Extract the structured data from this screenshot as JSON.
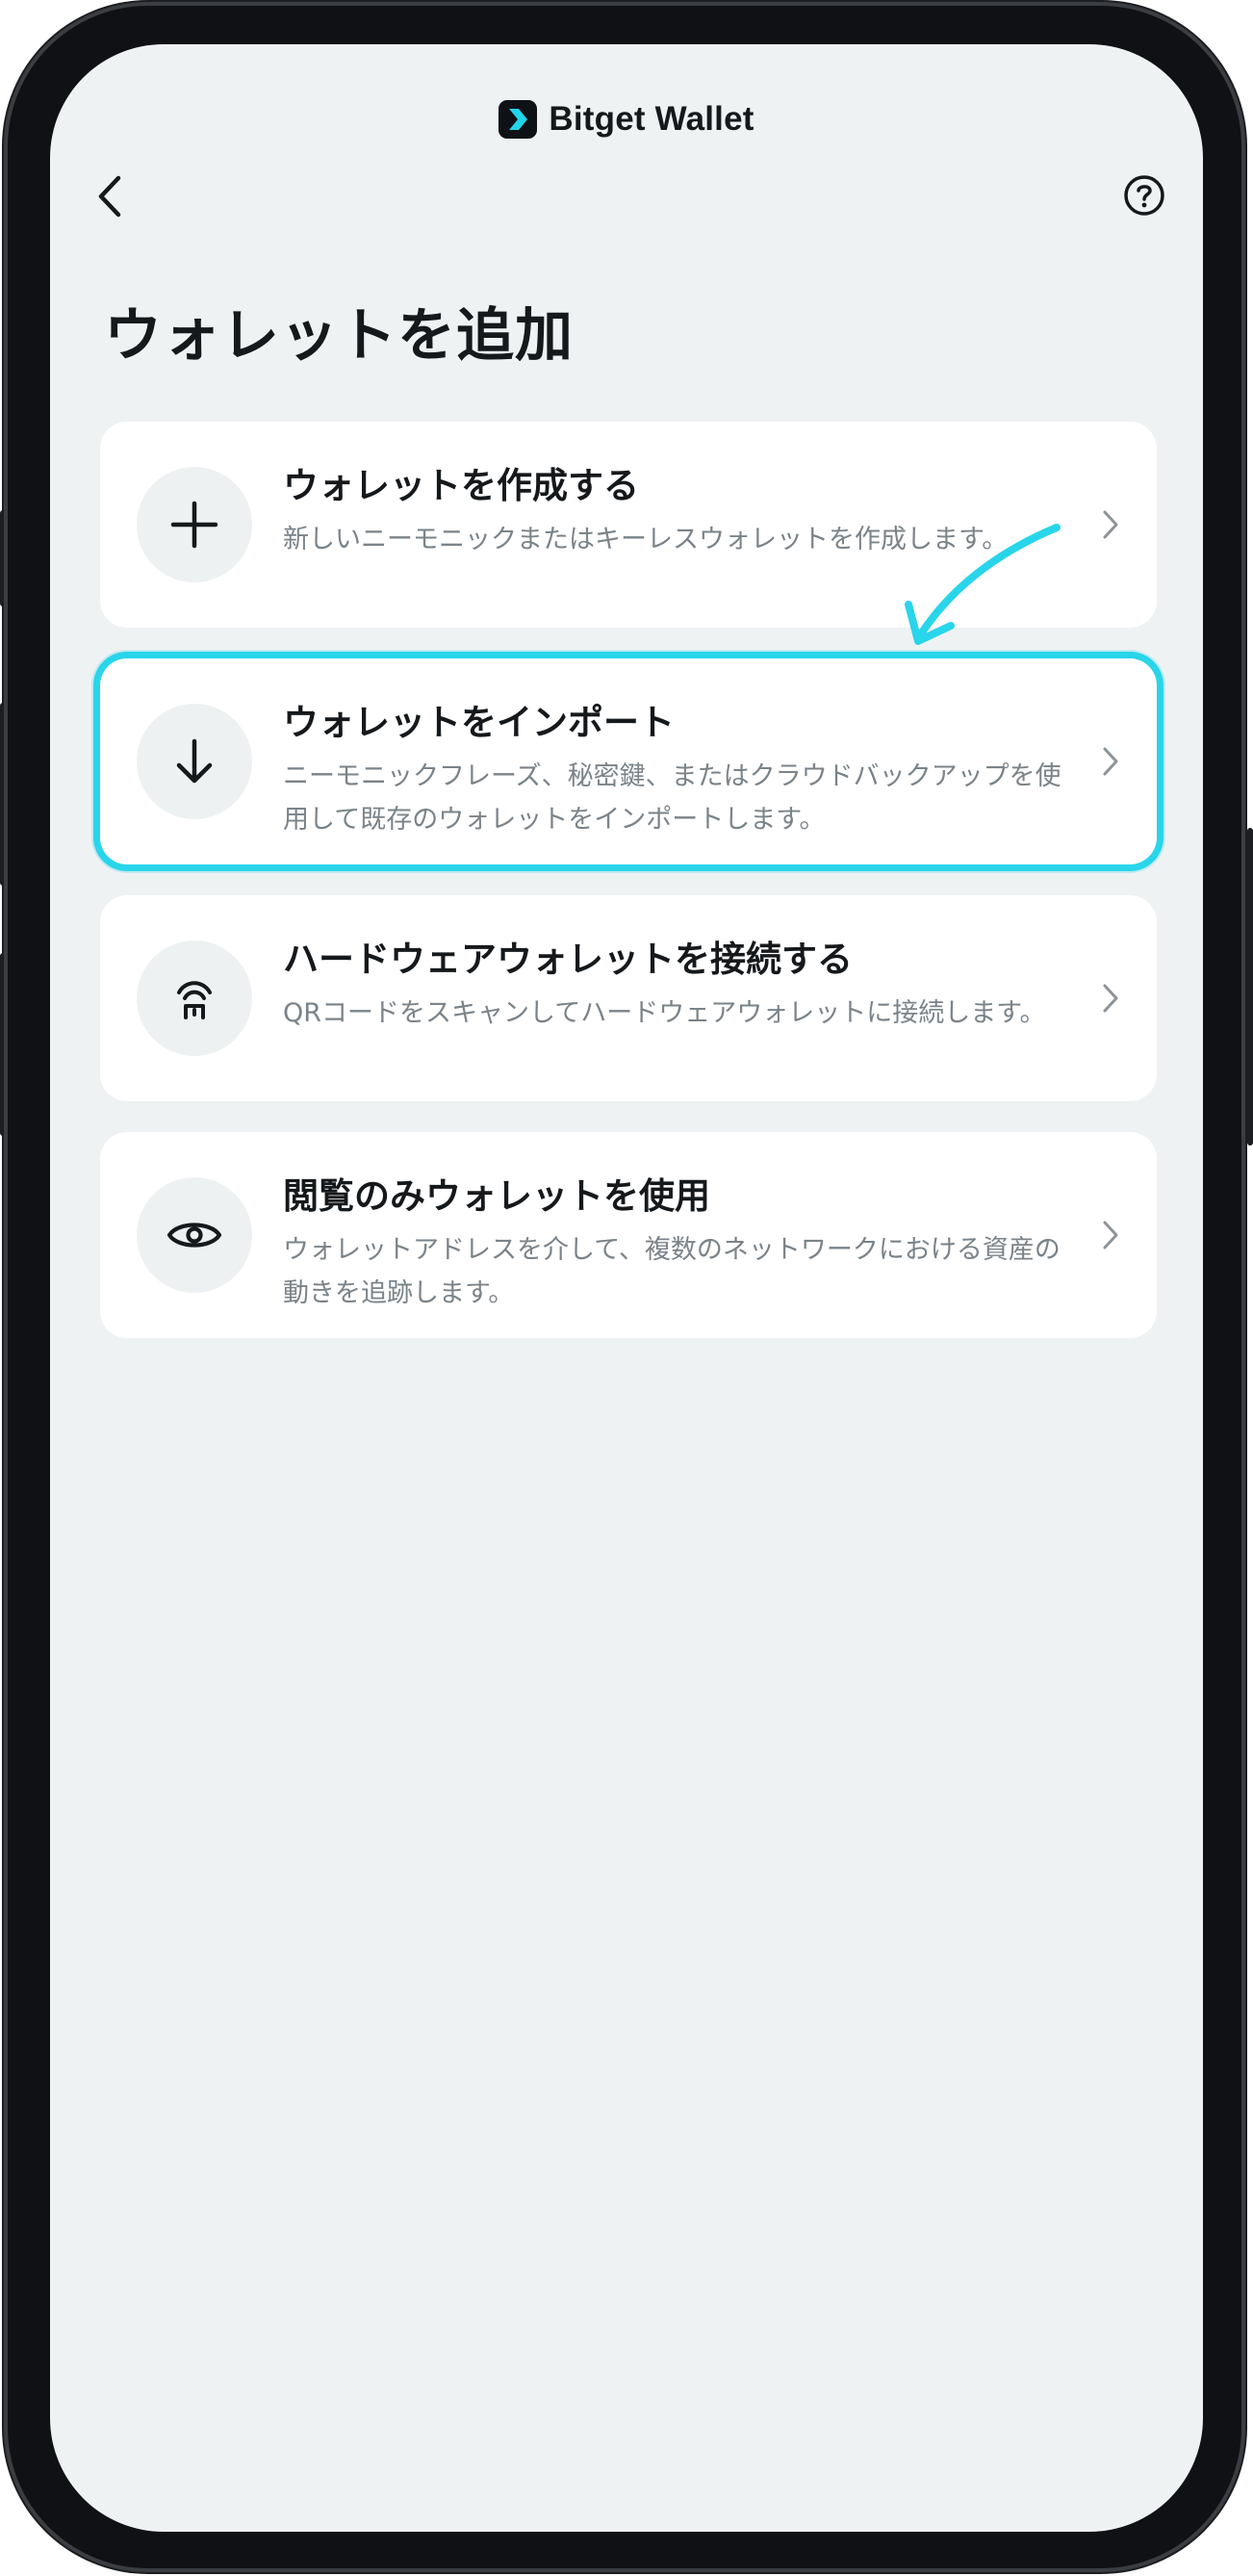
{
  "header": {
    "brand_name": "Bitget Wallet",
    "back_icon": "chevron-left-icon",
    "help_icon": "question-circle-icon"
  },
  "page": {
    "title": "ウォレットを追加"
  },
  "options": [
    {
      "icon": "plus-icon",
      "title": "ウォレットを作成する",
      "description": "新しいニーモニックまたはキーレスウォレットを作成します。"
    },
    {
      "icon": "arrow-down-icon",
      "title": "ウォレットをインポート",
      "description": "ニーモニックフレーズ、秘密鍵、またはクラウドバックアップを使用して既存のウォレットをインポートします。",
      "highlighted": true
    },
    {
      "icon": "hardware-wallet-icon",
      "title": "ハードウェアウォレットを接続する",
      "description": "QRコードをスキャンしてハードウェアウォレットに接続します。"
    },
    {
      "icon": "eye-icon",
      "title": "閲覧のみウォレットを使用",
      "description": "ウォレットアドレスを介して、複数のネットワークにおける資産の動きを追跡します。"
    }
  ],
  "colors": {
    "screen_background": "#eff2f3",
    "card_background": "#ffffff",
    "highlight": "#29d5ea",
    "text_primary": "#15191c",
    "text_secondary": "#7a8389"
  }
}
